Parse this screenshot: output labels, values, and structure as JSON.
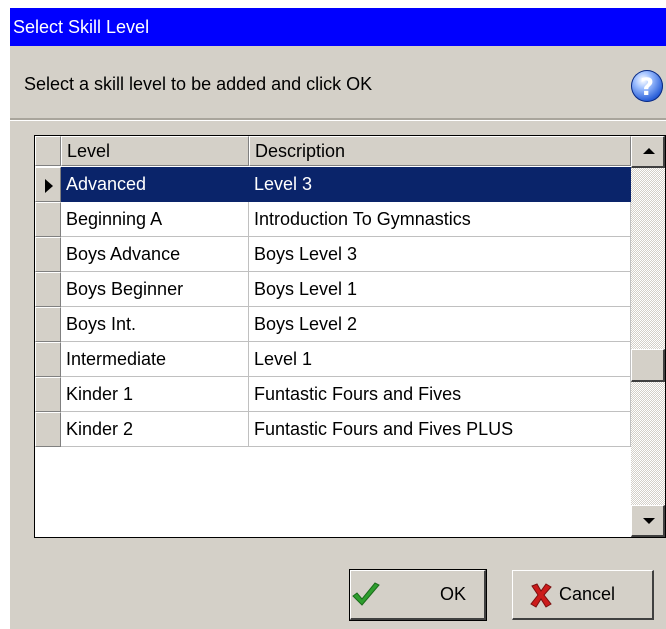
{
  "window": {
    "title": "Select Skill Level"
  },
  "instruction": {
    "text": "Select a skill level to be added and click OK",
    "help_icon": "question-mark-help-icon"
  },
  "grid": {
    "columns": [
      "Level",
      "Description"
    ],
    "selected_index": 0,
    "rows": [
      {
        "level": "Advanced",
        "description": "Level 3"
      },
      {
        "level": "Beginning A",
        "description": "Introduction To Gymnastics"
      },
      {
        "level": "Boys Advance",
        "description": "Boys Level 3"
      },
      {
        "level": "Boys Beginner",
        "description": "Boys Level 1"
      },
      {
        "level": "Boys Int.",
        "description": "Boys Level 2"
      },
      {
        "level": "Intermediate",
        "description": "Level 1"
      },
      {
        "level": "Kinder 1",
        "description": "Funtastic Fours and Fives"
      },
      {
        "level": "Kinder 2",
        "description": "Funtastic Fours and Fives PLUS"
      }
    ]
  },
  "buttons": {
    "ok": "OK",
    "ok_icon": "checkmark-icon",
    "cancel": "Cancel",
    "cancel_icon": "red-x-icon"
  },
  "colors": {
    "titlebar": "#0000ff",
    "selection": "#0a246a",
    "dialog_bg": "#d4d0c8"
  }
}
